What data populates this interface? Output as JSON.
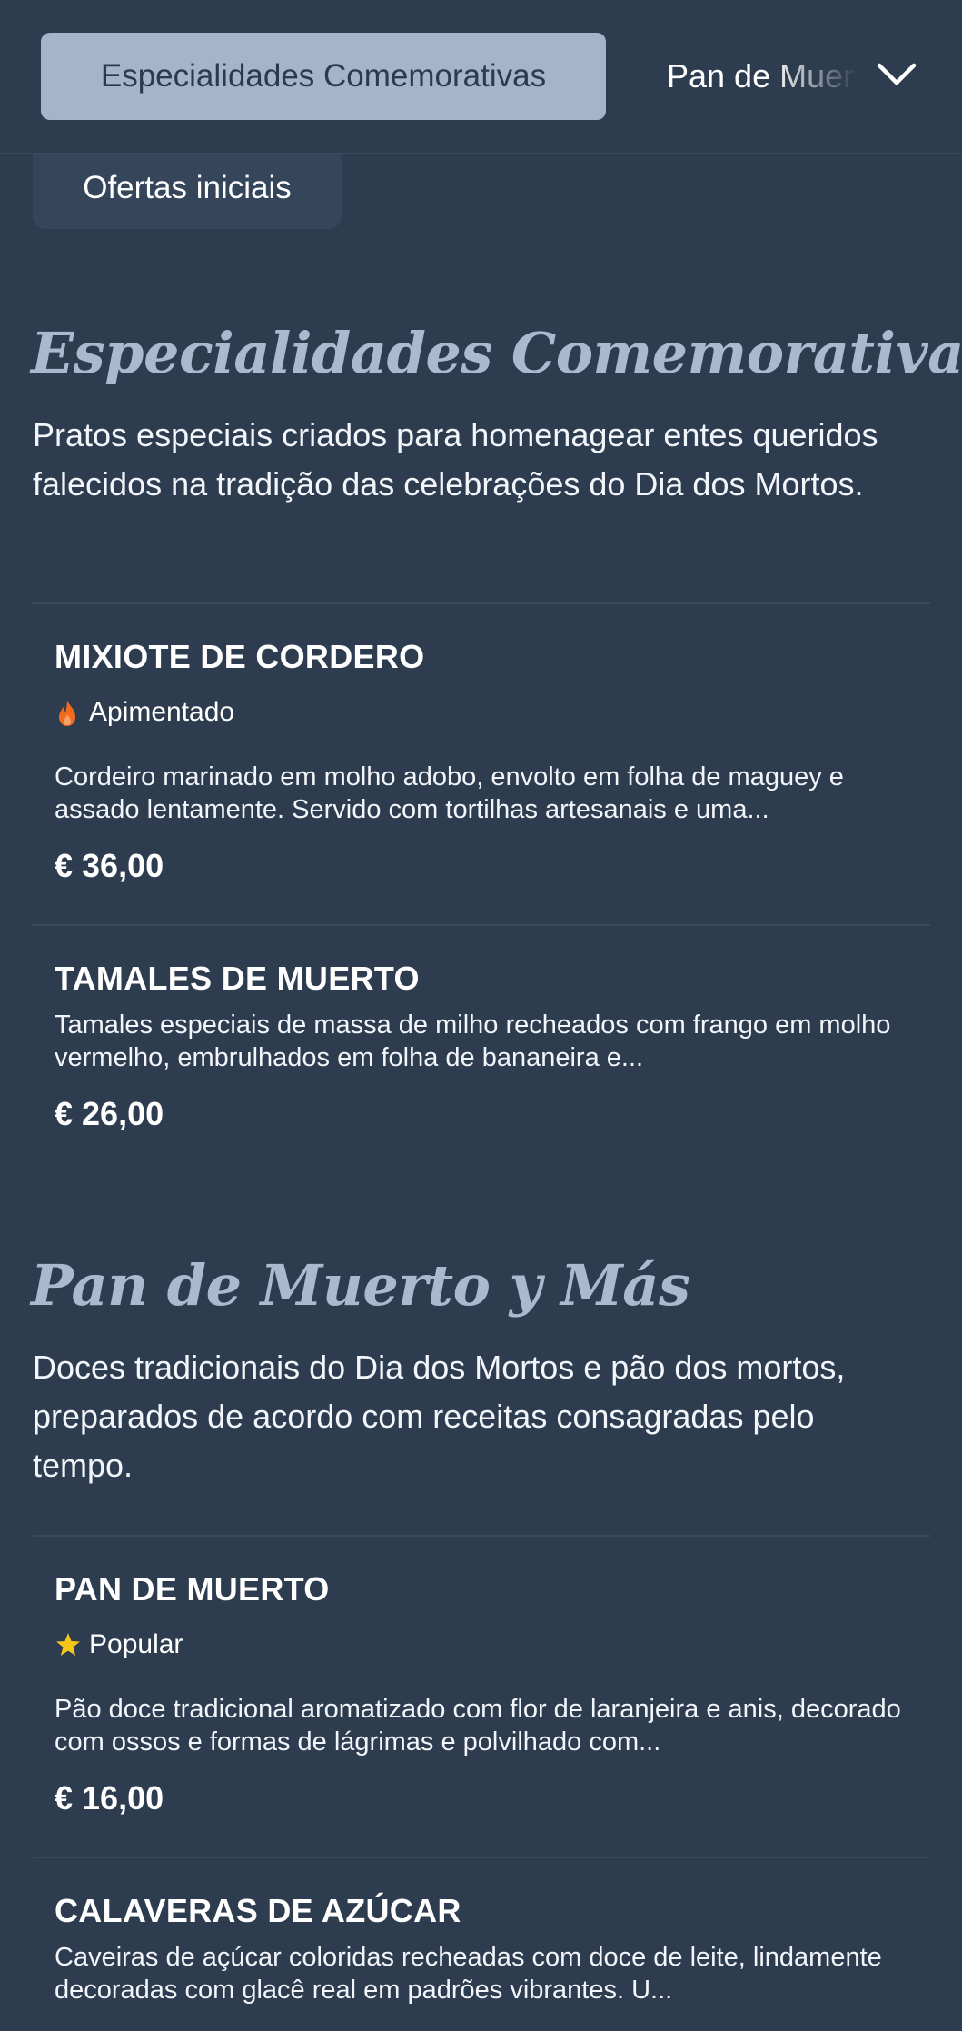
{
  "nav": {
    "active_tab": "Especialidades Comemorativas",
    "next_tab": "Pan de Muerto y Más",
    "quick_link": "Ofertas iniciais"
  },
  "sections": [
    {
      "title": "Especialidades Comemorativas",
      "description": "Pratos especiais criados para homenagear entes queridos falecidos na tradição das celebrações do Dia dos Mortos.",
      "items": [
        {
          "name": "MIXIOTE DE CORDERO",
          "tag": "Apimentado",
          "tag_icon": "flame-icon",
          "description": "Cordeiro marinado em molho adobo, envolto em folha de maguey e assado lentamente. Servido com tortilhas artesanais e uma...",
          "price": "€ 36,00"
        },
        {
          "name": "TAMALES DE MUERTO",
          "description": "Tamales especiais de massa de milho recheados com frango em molho vermelho, embrulhados em folha de bananeira e...",
          "price": "€ 26,00"
        }
      ]
    },
    {
      "title": "Pan de Muerto y Más",
      "description": "Doces tradicionais do Dia dos Mortos e pão dos mortos, preparados de acordo com receitas consagradas pelo tempo.",
      "items": [
        {
          "name": "PAN DE MUERTO",
          "tag": "Popular",
          "tag_icon": "star-icon",
          "description": "Pão doce tradicional aromatizado com flor de laranjeira e anis, decorado com ossos e formas de lágrimas e polvilhado com...",
          "price": "€ 16,00"
        },
        {
          "name": "CALAVERAS DE AZÚCAR",
          "description": "Caveiras de açúcar coloridas recheadas com doce de leite, lindamente decoradas com glacê real em padrões vibrantes. U..."
        }
      ]
    }
  ],
  "colors": {
    "background": "#2d3c4f",
    "active_tab_bg": "#a4b4ca",
    "section_title": "#aab9ce",
    "flame": "#f26b1d",
    "star": "#f5c518"
  }
}
